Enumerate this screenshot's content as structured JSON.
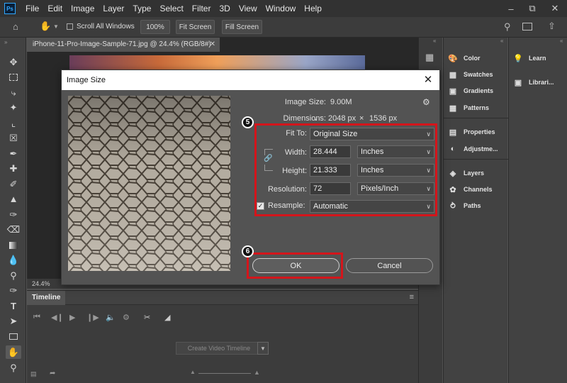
{
  "app": {
    "logo": "Ps",
    "menu": [
      "File",
      "Edit",
      "Image",
      "Layer",
      "Type",
      "Select",
      "Filter",
      "3D",
      "View",
      "Window",
      "Help"
    ]
  },
  "options_bar": {
    "scroll_all_windows": "Scroll All Windows",
    "zoom_100": "100%",
    "fit_screen": "Fit Screen",
    "fill_screen": "Fill Screen"
  },
  "document": {
    "tab_title": "iPhone-11-Pro-Image-Sample-71.jpg @ 24.4% (RGB/8#)",
    "zoom": "24.4%"
  },
  "timeline": {
    "title": "Timeline",
    "create_button": "Create Video Timeline"
  },
  "panels": {
    "group1": [
      "Color",
      "Swatches",
      "Gradients",
      "Patterns"
    ],
    "group2": [
      "Properties",
      "Adjustme..."
    ],
    "group3": [
      "Layers",
      "Channels",
      "Paths"
    ],
    "learn": [
      "Learn",
      "Librari..."
    ]
  },
  "dialog": {
    "title": "Image Size",
    "image_size_label": "Image Size:",
    "image_size_value": "9.00M",
    "dimensions_label": "Dimensions:",
    "dimensions_w": "2048 px",
    "dimensions_x": "×",
    "dimensions_h": "1536 px",
    "fit_to_label": "Fit To:",
    "fit_to_value": "Original Size",
    "width_label": "Width:",
    "width_value": "28.444",
    "width_unit": "Inches",
    "height_label": "Height:",
    "height_value": "21.333",
    "height_unit": "Inches",
    "resolution_label": "Resolution:",
    "resolution_value": "72",
    "resolution_unit": "Pixels/Inch",
    "resample_label": "Resample:",
    "resample_checked": true,
    "resample_value": "Automatic",
    "ok_label": "OK",
    "cancel_label": "Cancel"
  },
  "annotations": {
    "step5": "5",
    "step6": "6",
    "highlight_color": "#d4151b"
  }
}
